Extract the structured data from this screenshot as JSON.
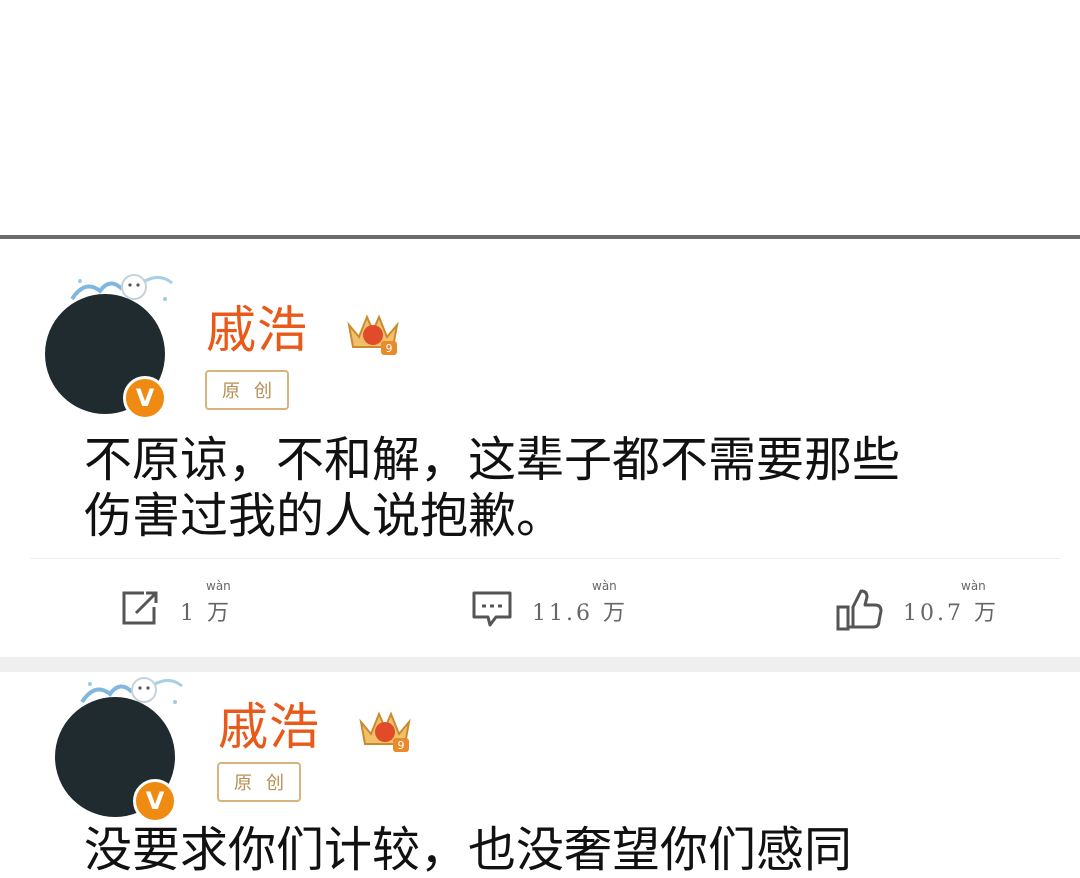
{
  "posts": [
    {
      "username": "戚浩",
      "tag": "原创",
      "text": "不原谅，不和解，这辈子都不需要那些\n伤害过我的人说抱歉。",
      "actions": {
        "repost": {
          "count": "1 万",
          "pinyin": "wàn",
          "icon": "repost-icon"
        },
        "comment": {
          "count": "11.6 万",
          "pinyin": "wàn",
          "icon": "comment-icon"
        },
        "like": {
          "count": "10.7 万",
          "pinyin": "wàn",
          "icon": "like-icon"
        }
      }
    },
    {
      "username": "戚浩",
      "tag": "原创",
      "text": "没要求你们计较，也没奢望你们感同"
    }
  ],
  "colors": {
    "username": "#e8591a",
    "verified_badge": "#ef8a13",
    "origin_tag": "#d7b47d",
    "avatar": "#202b2f",
    "divider": "#6b6b6b",
    "gap": "#efefef"
  }
}
